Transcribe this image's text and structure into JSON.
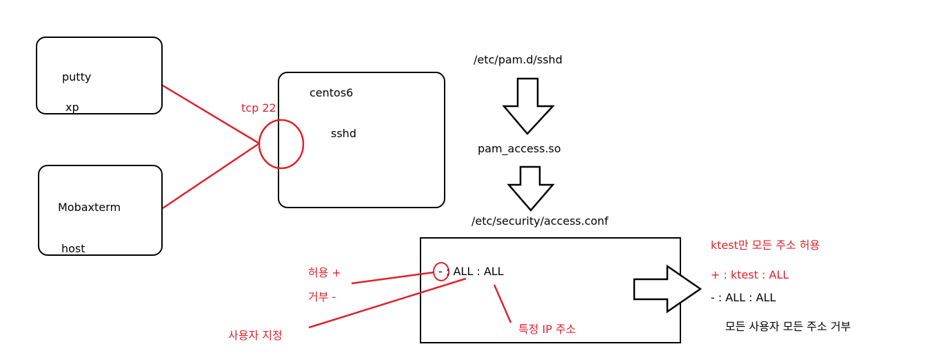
{
  "clients": {
    "putty": {
      "name": "putty",
      "os": "xp"
    },
    "mobaxterm": {
      "name": "Mobaxterm",
      "os": "host"
    }
  },
  "server": {
    "name": "centos6",
    "service": "sshd",
    "port_label": "tcp 22"
  },
  "flow": {
    "step1": "/etc/pam.d/sshd",
    "step2": "pam_access.so",
    "step3": "/etc/security/access.conf"
  },
  "access_conf": {
    "rule_sign": "-",
    "rule_rest": ": ALL : ALL",
    "annotations": {
      "allow": "허용 +",
      "deny": "거부 -",
      "user": "사용자 지정",
      "ip": "특정 IP 주소"
    }
  },
  "example": {
    "title": "ktest만 모든 주소 허용",
    "line1": "+ : ktest : ALL",
    "line2": "- : ALL : ALL",
    "note": "모든 사용자 모든 주소 거부"
  },
  "colors": {
    "accent": "#e0202a",
    "line": "#000000"
  }
}
